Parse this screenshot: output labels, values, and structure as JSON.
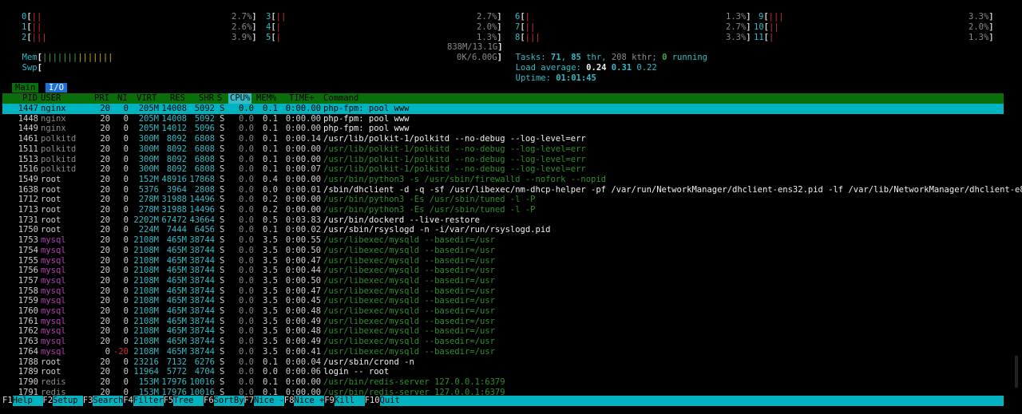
{
  "cpus": [
    {
      "id": "0",
      "bars": "||",
      "pct": "2.7%"
    },
    {
      "id": "1",
      "bars": "||",
      "pct": "2.6%"
    },
    {
      "id": "2",
      "bars": "|||",
      "pct": "3.9%"
    },
    {
      "id": "3",
      "bars": "||",
      "pct": "2.7%"
    },
    {
      "id": "4",
      "bars": "|",
      "pct": "2.0%"
    },
    {
      "id": "5",
      "bars": "|",
      "pct": "1.3%"
    },
    {
      "id": "6",
      "bars": "|",
      "pct": "1.3%"
    },
    {
      "id": "7",
      "bars": "||",
      "pct": "2.7%"
    },
    {
      "id": "8",
      "bars": "|||",
      "pct": "3.3%"
    },
    {
      "id": "9",
      "bars": "|||",
      "pct": "3.3%"
    },
    {
      "id": "10",
      "bars": "||",
      "pct": "2.0%"
    },
    {
      "id": "11",
      "bars": "|",
      "pct": "1.3%"
    }
  ],
  "mem": {
    "label": "Mem",
    "bars_green": "|||||||",
    "bars_yellow": "|||||||",
    "value": "838M/13.1G"
  },
  "swp": {
    "label": "Swp",
    "value": "0K/6.00G"
  },
  "tasks": {
    "label": "Tasks: ",
    "count": "71",
    "sep": ", ",
    "thr": "85",
    "thr_label": " thr, ",
    "kthr": "208",
    "kthr_label": " kthr; ",
    "running": "0",
    "running_label": " running"
  },
  "load": {
    "label": "Load average: ",
    "l1": "0.24",
    "l5": "0.31",
    "l15": "0.22"
  },
  "uptime": {
    "label": "Uptime: ",
    "value": "01:01:45"
  },
  "tabs": [
    {
      "label": "Main",
      "active": true
    },
    {
      "label": "I/O",
      "active": false
    }
  ],
  "columns": [
    "PID",
    "USER",
    "PRI",
    "NI",
    "VIRT",
    "RES",
    "SHR",
    "S",
    "CPU%",
    "MEM%",
    "TIME+",
    "Command"
  ],
  "sorted_column": "CPU%",
  "processes": [
    {
      "pid": "1447",
      "user": "nginx",
      "pri": "20",
      "ni": "0",
      "virt": "205M",
      "res": "14008",
      "shr": "5092",
      "s": "S",
      "cpu": "0.0",
      "mem": "0.1",
      "time": "0:00.00",
      "cmd": "php-fpm: pool www",
      "cmd_style": "white",
      "selected": true
    },
    {
      "pid": "1448",
      "user": "nginx",
      "pri": "20",
      "ni": "0",
      "virt": "205M",
      "res": "14008",
      "shr": "5092",
      "s": "S",
      "cpu": "0.0",
      "mem": "0.1",
      "time": "0:00.00",
      "cmd": "php-fpm: pool www",
      "cmd_style": "white"
    },
    {
      "pid": "1449",
      "user": "nginx",
      "pri": "20",
      "ni": "0",
      "virt": "205M",
      "res": "14012",
      "shr": "5096",
      "s": "S",
      "cpu": "0.0",
      "mem": "0.1",
      "time": "0:00.00",
      "cmd": "php-fpm: pool www",
      "cmd_style": "white"
    },
    {
      "pid": "1461",
      "user": "polkitd",
      "pri": "20",
      "ni": "0",
      "virt": "300M",
      "res": "8092",
      "shr": "6808",
      "s": "S",
      "cpu": "0.0",
      "mem": "0.1",
      "time": "0:00.14",
      "cmd": "/usr/lib/polkit-1/polkitd --no-debug --log-level=err",
      "cmd_style": "white"
    },
    {
      "pid": "1511",
      "user": "polkitd",
      "pri": "20",
      "ni": "0",
      "virt": "300M",
      "res": "8092",
      "shr": "6808",
      "s": "S",
      "cpu": "0.0",
      "mem": "0.1",
      "time": "0:00.00",
      "cmd": "/usr/lib/polkit-1/polkitd --no-debug --log-level=err",
      "cmd_style": "green"
    },
    {
      "pid": "1513",
      "user": "polkitd",
      "pri": "20",
      "ni": "0",
      "virt": "300M",
      "res": "8092",
      "shr": "6808",
      "s": "S",
      "cpu": "0.0",
      "mem": "0.1",
      "time": "0:00.00",
      "cmd": "/usr/lib/polkit-1/polkitd --no-debug --log-level=err",
      "cmd_style": "green"
    },
    {
      "pid": "1516",
      "user": "polkitd",
      "pri": "20",
      "ni": "0",
      "virt": "300M",
      "res": "8092",
      "shr": "6808",
      "s": "S",
      "cpu": "0.0",
      "mem": "0.1",
      "time": "0:00.07",
      "cmd": "/usr/lib/polkit-1/polkitd --no-debug --log-level=err",
      "cmd_style": "green"
    },
    {
      "pid": "1549",
      "user": "root",
      "pri": "20",
      "ni": "0",
      "virt": "152M",
      "res": "48916",
      "shr": "17868",
      "s": "S",
      "cpu": "0.0",
      "mem": "0.4",
      "time": "0:00.00",
      "cmd": "/usr/bin/python3 -s /usr/sbin/firewalld --nofork --nopid",
      "cmd_style": "green"
    },
    {
      "pid": "1638",
      "user": "root",
      "pri": "20",
      "ni": "0",
      "virt": "5376",
      "res": "3964",
      "shr": "2808",
      "s": "S",
      "cpu": "0.0",
      "mem": "0.0",
      "time": "0:00.01",
      "cmd": "/sbin/dhclient -d -q -sf /usr/libexec/nm-dhcp-helper -pf /var/run/NetworkManager/dhclient-ens32.pid -lf /var/lib/NetworkManager/dhclient-e86fd",
      "cmd_style": "white"
    },
    {
      "pid": "1712",
      "user": "root",
      "pri": "20",
      "ni": "0",
      "virt": "278M",
      "res": "31988",
      "shr": "14496",
      "s": "S",
      "cpu": "0.0",
      "mem": "0.2",
      "time": "0:00.00",
      "cmd": "/usr/bin/python3 -Es /usr/sbin/tuned -l -P",
      "cmd_style": "green"
    },
    {
      "pid": "1713",
      "user": "root",
      "pri": "20",
      "ni": "0",
      "virt": "278M",
      "res": "31988",
      "shr": "14496",
      "s": "S",
      "cpu": "0.0",
      "mem": "0.2",
      "time": "0:00.00",
      "cmd": "/usr/bin/python3 -Es /usr/sbin/tuned -l -P",
      "cmd_style": "green"
    },
    {
      "pid": "1731",
      "user": "root",
      "pri": "20",
      "ni": "0",
      "virt": "2202M",
      "res": "67472",
      "shr": "43664",
      "s": "S",
      "cpu": "0.0",
      "mem": "0.5",
      "time": "0:03.83",
      "cmd": "/usr/bin/dockerd --live-restore",
      "cmd_style": "white"
    },
    {
      "pid": "1750",
      "user": "root",
      "pri": "20",
      "ni": "0",
      "virt": "224M",
      "res": "7444",
      "shr": "6456",
      "s": "S",
      "cpu": "0.0",
      "mem": "0.1",
      "time": "0:00.02",
      "cmd": "/usr/sbin/rsyslogd -n -i/var/run/rsyslogd.pid",
      "cmd_style": "white"
    },
    {
      "pid": "1753",
      "user": "mysql",
      "pri": "20",
      "ni": "0",
      "virt": "2108M",
      "res": "465M",
      "shr": "38744",
      "s": "S",
      "cpu": "0.0",
      "mem": "3.5",
      "time": "0:00.55",
      "cmd": "/usr/libexec/mysqld --basedir=/usr",
      "cmd_style": "green"
    },
    {
      "pid": "1754",
      "user": "mysql",
      "pri": "20",
      "ni": "0",
      "virt": "2108M",
      "res": "465M",
      "shr": "38744",
      "s": "S",
      "cpu": "0.0",
      "mem": "3.5",
      "time": "0:00.50",
      "cmd": "/usr/libexec/mysqld --basedir=/usr",
      "cmd_style": "green"
    },
    {
      "pid": "1755",
      "user": "mysql",
      "pri": "20",
      "ni": "0",
      "virt": "2108M",
      "res": "465M",
      "shr": "38744",
      "s": "S",
      "cpu": "0.0",
      "mem": "3.5",
      "time": "0:00.47",
      "cmd": "/usr/libexec/mysqld --basedir=/usr",
      "cmd_style": "green"
    },
    {
      "pid": "1756",
      "user": "mysql",
      "pri": "20",
      "ni": "0",
      "virt": "2108M",
      "res": "465M",
      "shr": "38744",
      "s": "S",
      "cpu": "0.0",
      "mem": "3.5",
      "time": "0:00.44",
      "cmd": "/usr/libexec/mysqld --basedir=/usr",
      "cmd_style": "green"
    },
    {
      "pid": "1757",
      "user": "mysql",
      "pri": "20",
      "ni": "0",
      "virt": "2108M",
      "res": "465M",
      "shr": "38744",
      "s": "S",
      "cpu": "0.0",
      "mem": "3.5",
      "time": "0:00.50",
      "cmd": "/usr/libexec/mysqld --basedir=/usr",
      "cmd_style": "green"
    },
    {
      "pid": "1758",
      "user": "mysql",
      "pri": "20",
      "ni": "0",
      "virt": "2108M",
      "res": "465M",
      "shr": "38744",
      "s": "S",
      "cpu": "0.0",
      "mem": "3.5",
      "time": "0:00.47",
      "cmd": "/usr/libexec/mysqld --basedir=/usr",
      "cmd_style": "green"
    },
    {
      "pid": "1759",
      "user": "mysql",
      "pri": "20",
      "ni": "0",
      "virt": "2108M",
      "res": "465M",
      "shr": "38744",
      "s": "S",
      "cpu": "0.0",
      "mem": "3.5",
      "time": "0:00.45",
      "cmd": "/usr/libexec/mysqld --basedir=/usr",
      "cmd_style": "green"
    },
    {
      "pid": "1760",
      "user": "mysql",
      "pri": "20",
      "ni": "0",
      "virt": "2108M",
      "res": "465M",
      "shr": "38744",
      "s": "S",
      "cpu": "0.0",
      "mem": "3.5",
      "time": "0:00.48",
      "cmd": "/usr/libexec/mysqld --basedir=/usr",
      "cmd_style": "green"
    },
    {
      "pid": "1761",
      "user": "mysql",
      "pri": "20",
      "ni": "0",
      "virt": "2108M",
      "res": "465M",
      "shr": "38744",
      "s": "S",
      "cpu": "0.0",
      "mem": "3.5",
      "time": "0:00.49",
      "cmd": "/usr/libexec/mysqld --basedir=/usr",
      "cmd_style": "green"
    },
    {
      "pid": "1762",
      "user": "mysql",
      "pri": "20",
      "ni": "0",
      "virt": "2108M",
      "res": "465M",
      "shr": "38744",
      "s": "S",
      "cpu": "0.0",
      "mem": "3.5",
      "time": "0:00.48",
      "cmd": "/usr/libexec/mysqld --basedir=/usr",
      "cmd_style": "green"
    },
    {
      "pid": "1763",
      "user": "mysql",
      "pri": "20",
      "ni": "0",
      "virt": "2108M",
      "res": "465M",
      "shr": "38744",
      "s": "S",
      "cpu": "0.0",
      "mem": "3.5",
      "time": "0:00.49",
      "cmd": "/usr/libexec/mysqld --basedir=/usr",
      "cmd_style": "green"
    },
    {
      "pid": "1764",
      "user": "mysql",
      "pri": "0",
      "ni": "-20",
      "virt": "2108M",
      "res": "465M",
      "shr": "38744",
      "s": "S",
      "cpu": "0.0",
      "mem": "3.5",
      "time": "0:00.41",
      "cmd": "/usr/libexec/mysqld --basedir=/usr",
      "cmd_style": "green"
    },
    {
      "pid": "1788",
      "user": "root",
      "pri": "20",
      "ni": "0",
      "virt": "23216",
      "res": "7132",
      "shr": "6276",
      "s": "S",
      "cpu": "0.0",
      "mem": "0.1",
      "time": "0:00.04",
      "cmd": "/usr/sbin/crond -n",
      "cmd_style": "white"
    },
    {
      "pid": "1789",
      "user": "root",
      "pri": "20",
      "ni": "0",
      "virt": "11964",
      "res": "5772",
      "shr": "4704",
      "s": "S",
      "cpu": "0.0",
      "mem": "0.0",
      "time": "0:00.06",
      "cmd": "login -- root",
      "cmd_style": "white"
    },
    {
      "pid": "1790",
      "user": "redis",
      "pri": "20",
      "ni": "0",
      "virt": "153M",
      "res": "17976",
      "shr": "10016",
      "s": "S",
      "cpu": "0.0",
      "mem": "0.1",
      "time": "0:00.00",
      "cmd": "/usr/bin/redis-server 127.0.0.1:6379",
      "cmd_style": "green"
    },
    {
      "pid": "1791",
      "user": "redis",
      "pri": "20",
      "ni": "0",
      "virt": "153M",
      "res": "17976",
      "shr": "10016",
      "s": "S",
      "cpu": "0.0",
      "mem": "0.1",
      "time": "0:00.00",
      "cmd": "/usr/bin/redis-server 127.0.0.1:6379",
      "cmd_style": "green"
    }
  ],
  "fkeys": [
    {
      "key": "F1",
      "label": "Help  "
    },
    {
      "key": "F2",
      "label": "Setup "
    },
    {
      "key": "F3",
      "label": "Search"
    },
    {
      "key": "F4",
      "label": "Filter"
    },
    {
      "key": "F5",
      "label": "Tree  "
    },
    {
      "key": "F6",
      "label": "SortBy"
    },
    {
      "key": "F7",
      "label": "Nice -"
    },
    {
      "key": "F8",
      "label": "Nice +"
    },
    {
      "key": "F9",
      "label": "Kill  "
    },
    {
      "key": "F10",
      "label": "Quit"
    }
  ],
  "colors": {
    "cyan": "#00b3c0",
    "header_green": "#0a6e0a",
    "mysql_user": "#b040b0",
    "nginx_user": "#8a8a8a"
  }
}
